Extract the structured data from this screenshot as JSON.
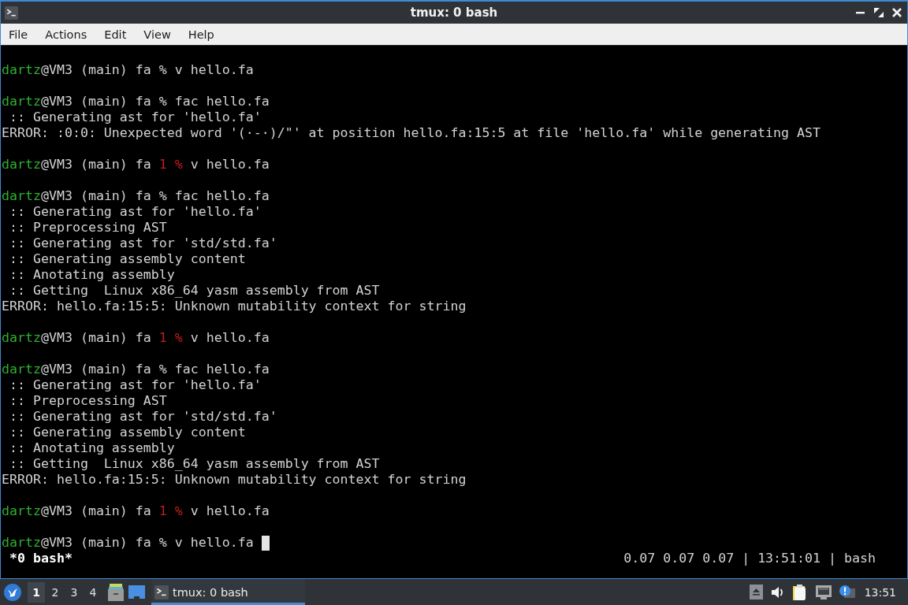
{
  "window": {
    "title": "tmux: 0 bash"
  },
  "menu": [
    "File",
    "Actions",
    "Edit",
    "View",
    "Help"
  ],
  "terminal": {
    "lines": [
      {
        "kind": "prompt",
        "user": "dartz",
        "location": "@VM3 (main) fa",
        "failed": false,
        "symbol": "%",
        "command": "v hello.fa",
        "cursor": false
      },
      {
        "kind": "prompt",
        "user": "dartz",
        "location": "@VM3 (main) fa",
        "failed": false,
        "symbol": "%",
        "command": "fac hello.fa",
        "cursor": false
      },
      {
        "kind": "output",
        "text": " :: Generating ast for 'hello.fa'"
      },
      {
        "kind": "output",
        "text": "ERROR: :0:0: Unexpected word '(·-·)/\"' at position hello.fa:15:5 at file 'hello.fa' while generating AST"
      },
      {
        "kind": "prompt",
        "user": "dartz",
        "location": "@VM3 (main) fa",
        "status": "1",
        "failed": true,
        "symbol": "%",
        "command": "v hello.fa",
        "cursor": false
      },
      {
        "kind": "prompt",
        "user": "dartz",
        "location": "@VM3 (main) fa",
        "failed": false,
        "symbol": "%",
        "command": "fac hello.fa",
        "cursor": false
      },
      {
        "kind": "output",
        "text": " :: Generating ast for 'hello.fa'"
      },
      {
        "kind": "output",
        "text": " :: Preprocessing AST"
      },
      {
        "kind": "output",
        "text": " :: Generating ast for 'std/std.fa'"
      },
      {
        "kind": "output",
        "text": " :: Generating assembly content"
      },
      {
        "kind": "output",
        "text": " :: Anotating assembly"
      },
      {
        "kind": "output",
        "text": " :: Getting  Linux x86_64 yasm assembly from AST"
      },
      {
        "kind": "output",
        "text": "ERROR: hello.fa:15:5: Unknown mutability context for string"
      },
      {
        "kind": "prompt",
        "user": "dartz",
        "location": "@VM3 (main) fa",
        "status": "1",
        "failed": true,
        "symbol": "%",
        "command": "v hello.fa",
        "cursor": false
      },
      {
        "kind": "prompt",
        "user": "dartz",
        "location": "@VM3 (main) fa",
        "failed": false,
        "symbol": "%",
        "command": "fac hello.fa",
        "cursor": false
      },
      {
        "kind": "output",
        "text": " :: Generating ast for 'hello.fa'"
      },
      {
        "kind": "output",
        "text": " :: Preprocessing AST"
      },
      {
        "kind": "output",
        "text": " :: Generating ast for 'std/std.fa'"
      },
      {
        "kind": "output",
        "text": " :: Generating assembly content"
      },
      {
        "kind": "output",
        "text": " :: Anotating assembly"
      },
      {
        "kind": "output",
        "text": " :: Getting  Linux x86_64 yasm assembly from AST"
      },
      {
        "kind": "output",
        "text": "ERROR: hello.fa:15:5: Unknown mutability context for string"
      },
      {
        "kind": "prompt",
        "user": "dartz",
        "location": "@VM3 (main) fa",
        "status": "1",
        "failed": true,
        "symbol": "%",
        "command": "v hello.fa",
        "cursor": false
      },
      {
        "kind": "prompt",
        "user": "dartz",
        "location": "@VM3 (main) fa",
        "failed": false,
        "symbol": "%",
        "command": "v hello.fa",
        "cursor": true
      }
    ]
  },
  "tmux_status": {
    "window": "*0 bash*",
    "right": "0.07 0.07 0.07 | 13:51:01 | bash"
  },
  "taskbar": {
    "workspaces": [
      {
        "label": "1",
        "selected": true
      },
      {
        "label": "2",
        "selected": false
      },
      {
        "label": "3",
        "selected": false
      },
      {
        "label": "4",
        "selected": false
      }
    ],
    "tasks": [
      {
        "label": "tmux: 0 bash",
        "selected": true
      }
    ],
    "clock": "13:51"
  }
}
